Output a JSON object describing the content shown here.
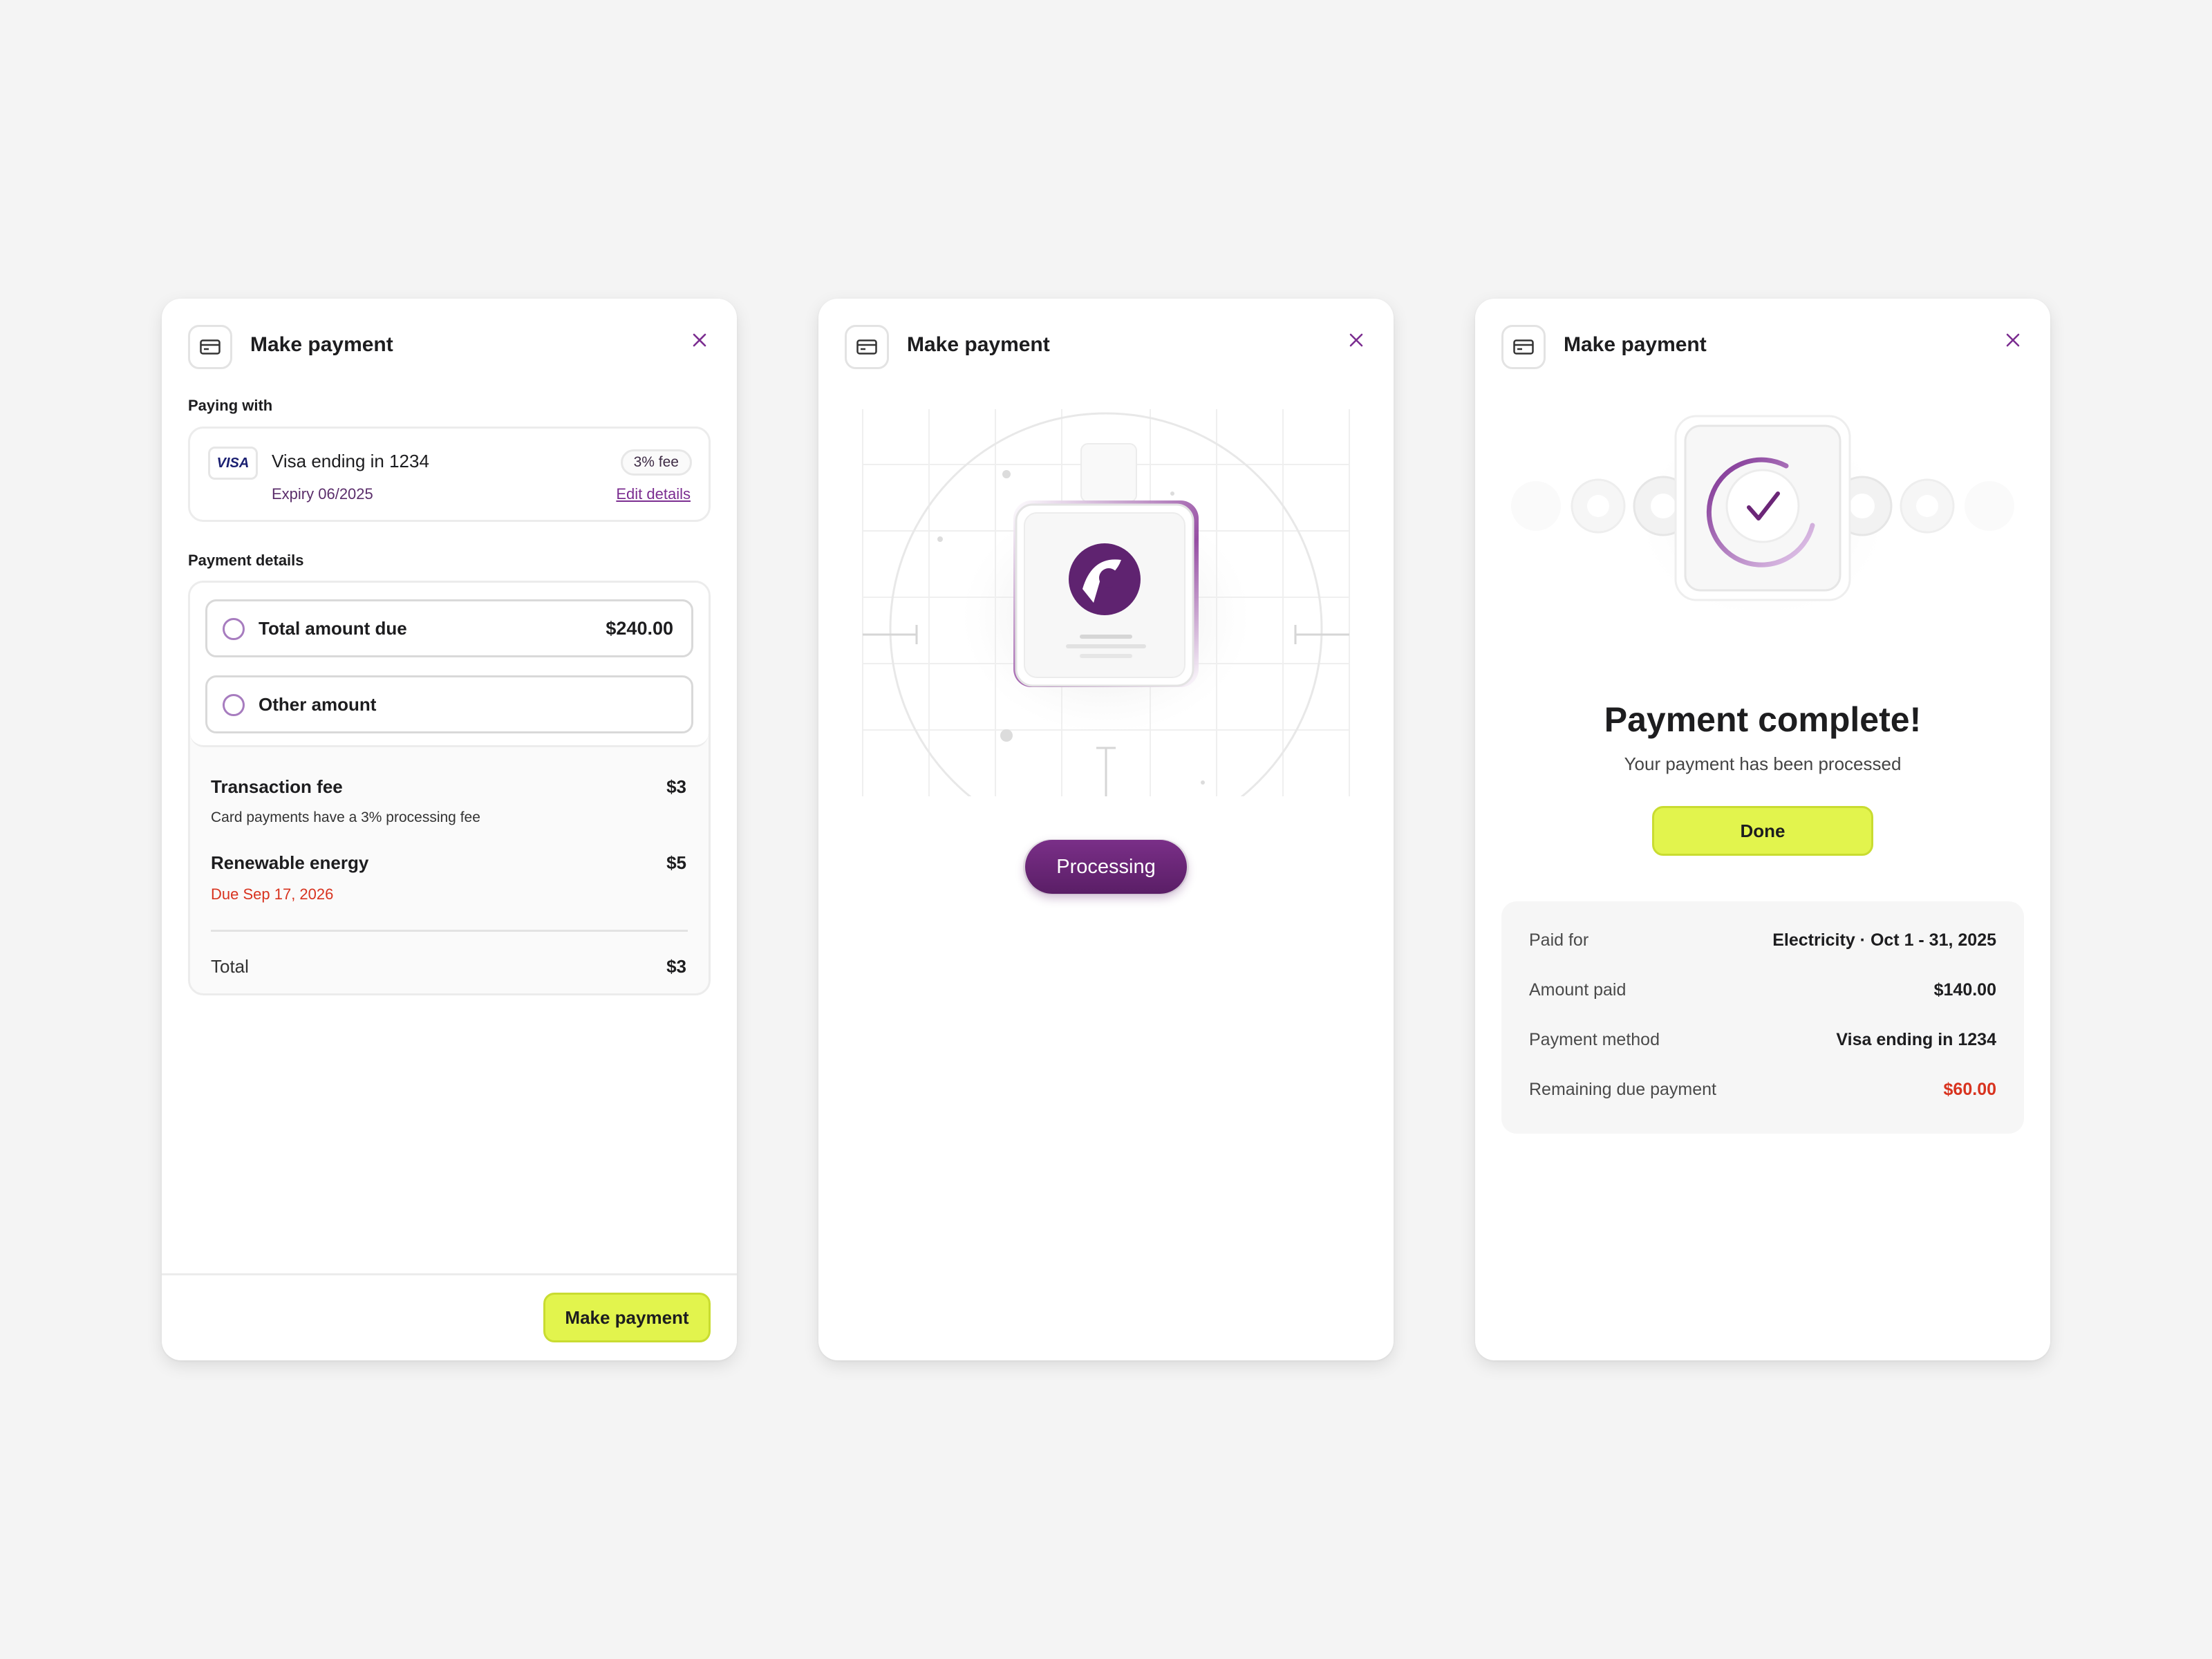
{
  "colors": {
    "accent": "#e2f44d",
    "brand": "#6b2677",
    "link": "#7b2d90",
    "danger": "#d8331f",
    "background": "#f4f4f4"
  },
  "card1": {
    "title": "Make payment",
    "header_icon": "credit-card-icon",
    "close_icon": "close-icon",
    "paying_with_label": "Paying with",
    "payment_card": {
      "brand": "VISA",
      "name": "Visa ending in 1234",
      "expiry": "Expiry 06/2025",
      "fee_badge": "3% fee",
      "edit_link": "Edit details"
    },
    "payment_details_label": "Payment details",
    "options": [
      {
        "label": "Total amount due",
        "amount": "$240.00"
      },
      {
        "label": "Other amount",
        "amount": ""
      }
    ],
    "lines": [
      {
        "title": "Transaction fee",
        "amount": "$3",
        "sub": "Card payments have a 3% processing fee"
      },
      {
        "title": "Renewable energy",
        "amount": "$5",
        "due": "Due Sep 17, 2026"
      }
    ],
    "total": {
      "label": "Total",
      "amount": "$3"
    },
    "submit_label": "Make payment"
  },
  "card2": {
    "title": "Make payment",
    "header_icon": "credit-card-icon",
    "close_icon": "close-icon",
    "status_label": "Processing",
    "illustration_icon": "brand-logo-icon"
  },
  "card3": {
    "title": "Make payment",
    "header_icon": "credit-card-icon",
    "close_icon": "close-icon",
    "success_icon": "checkmark-icon",
    "heading": "Payment complete!",
    "subheading": "Your payment has been processed",
    "done_label": "Done",
    "summary": [
      {
        "label": "Paid for",
        "value": "Electricity · Oct 1 - 31, 2025"
      },
      {
        "label": "Amount paid",
        "value": "$140.00"
      },
      {
        "label": "Payment method",
        "value": "Visa ending in 1234"
      },
      {
        "label": "Remaining due payment",
        "value": "$60.00"
      }
    ]
  }
}
